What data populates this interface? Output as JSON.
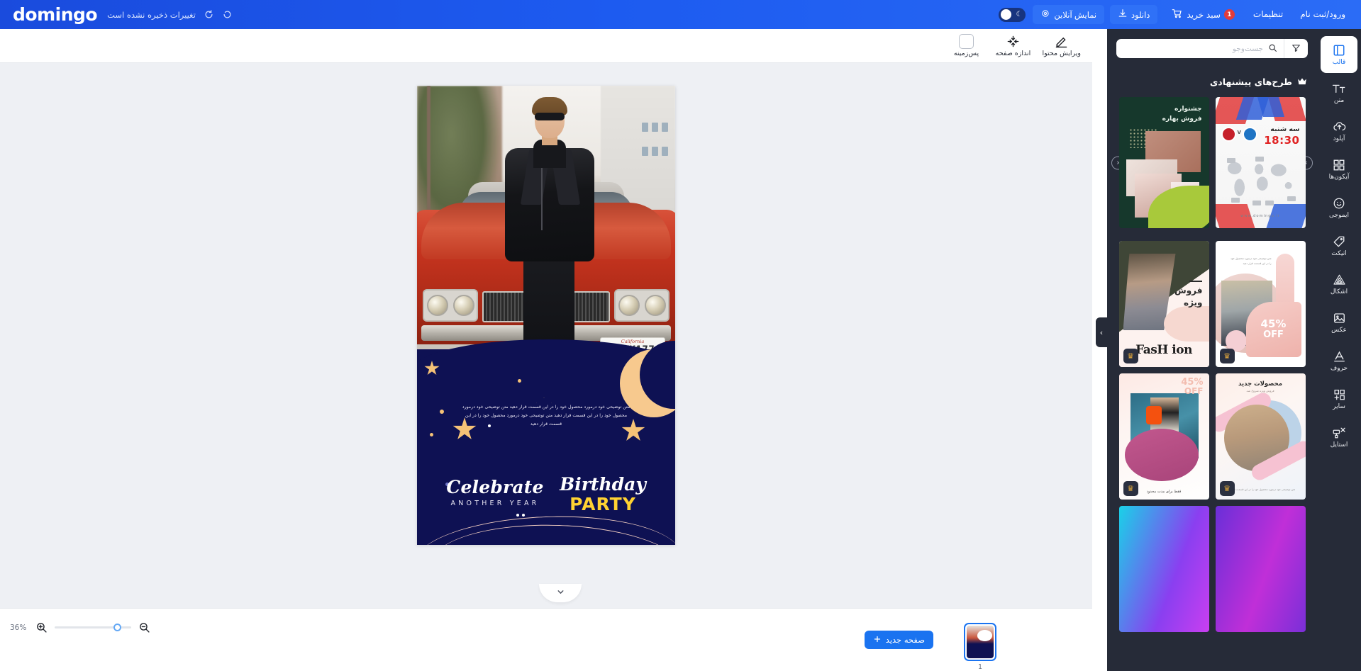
{
  "header": {
    "logo": "domingo",
    "save_status": "تغییرات ذخیره نشده است",
    "undo_icon": "undo-icon",
    "redo_icon": "redo-icon",
    "links": [
      {
        "label": "ورود/ثبت نام",
        "name": "login-register"
      },
      {
        "label": "تنظیمات",
        "name": "settings"
      }
    ],
    "cart": {
      "label": "سبد خرید",
      "badge": "1",
      "icon": "cart-icon"
    },
    "download": {
      "label": "دانلود",
      "icon": "download-icon"
    },
    "preview": {
      "label": "نمایش آنلاین",
      "icon": "eye-icon"
    },
    "theme_toggle": {
      "name": "dark-mode-toggle",
      "icon": "moon-icon",
      "state": "off"
    }
  },
  "toolbar": {
    "items": [
      {
        "label": "ویرایش محتوا",
        "icon": "pencil-icon",
        "name": "edit-content"
      },
      {
        "label": "اندازه صفحه",
        "icon": "resize-icon",
        "name": "page-size"
      },
      {
        "label": "پس‌زمینه",
        "icon": "background-swatch-icon",
        "name": "background"
      }
    ]
  },
  "canvas": {
    "design": {
      "plate_region": "California",
      "plate_number": "7ZWK177",
      "description": "متن توضیحی خود درمورد محصول خود را در این قسمت قرار دهید متن توضیحی خود درمورد محصول خود را در این قسمت قرار دهید متن توضیحی خود درمورد محصول خود را در این قسمت قرار دهید",
      "celebrate": "Celebrate",
      "another_year": "ANOTHER YEAR",
      "birthday": "Birthday",
      "party": "PARTY"
    },
    "scroll_down_icon": "chevron-down-icon"
  },
  "bottombar": {
    "zoom_percent": "36%",
    "zoom_in_icon": "zoom-in-icon",
    "zoom_out_icon": "zoom-out-icon",
    "new_page_label": "صفحه جدید",
    "new_page_icon": "plus-icon",
    "page_number": "1"
  },
  "panel": {
    "search_placeholder": "جست‌وجو",
    "search_value": "",
    "search_icon": "search-icon",
    "filter_icon": "filter-icon",
    "section_title": "طرح‌های پیشنهادی",
    "section_icon": "crown-icon",
    "carousel": {
      "prev_icon": "chevron-left-icon",
      "next_icon": "chevron-right-icon",
      "items": [
        {
          "name": "template-match-schedule",
          "day": "سه شنبه",
          "time": "18:30",
          "versus": "V",
          "url": "www.domingo.ir"
        },
        {
          "name": "template-spring-sale",
          "title_line1": "جشنواره",
          "title_line2": "فروش بهاره"
        }
      ]
    },
    "grid_items": [
      {
        "name": "template-45-off",
        "discount": "45%",
        "discount_label": "OFF",
        "body_text": "متن توضیحی خود درمورد محصول خود را در این قسمت قرار دهید",
        "premium": true,
        "badge_icon": "crown-icon"
      },
      {
        "name": "template-fashion-special-sale",
        "title_line1": "فروش",
        "title_line2": "ویژه",
        "wordmark": "FasH ion",
        "premium": true,
        "badge_icon": "crown-icon"
      },
      {
        "name": "template-new-products",
        "title": "محصولات جدید",
        "subtitle": "فروش ویژه شروع شد",
        "footer_text": "متن توضیحی خود درمورد محصول خود را در این قسمت قرار دهید",
        "premium": true,
        "badge_icon": "crown-icon"
      },
      {
        "name": "template-limited-time",
        "discount": "45%",
        "discount_label": "OFF",
        "caption": "فقط برای مدت محدود",
        "premium": true,
        "badge_icon": "crown-icon"
      },
      {
        "name": "template-purple-gradient",
        "premium": false
      },
      {
        "name": "template-cyan-gradient",
        "premium": false
      }
    ],
    "collapse_icon": "chevron-right-icon"
  },
  "rail": {
    "items": [
      {
        "label": "قالب",
        "icon": "layout-icon",
        "name": "rail-templates",
        "active": true
      },
      {
        "label": "متن",
        "icon": "text-icon",
        "name": "rail-text",
        "active": false
      },
      {
        "label": "آپلود",
        "icon": "upload-icon",
        "name": "rail-upload",
        "active": false
      },
      {
        "label": "آیکون‌ها",
        "icon": "grid-icon",
        "name": "rail-icons",
        "active": false
      },
      {
        "label": "ایموجی",
        "icon": "emoji-icon",
        "name": "rail-emoji",
        "active": false
      },
      {
        "label": "اتیکت",
        "icon": "tag-icon",
        "name": "rail-label",
        "active": false
      },
      {
        "label": "اشکال",
        "icon": "shapes-icon",
        "name": "rail-shapes",
        "active": false
      },
      {
        "label": "عکس",
        "icon": "image-icon",
        "name": "rail-photos",
        "active": false
      },
      {
        "label": "حروف",
        "icon": "font-icon",
        "name": "rail-fonts",
        "active": false
      },
      {
        "label": "سایر",
        "icon": "more-icon",
        "name": "rail-other",
        "active": false
      },
      {
        "label": "استایل",
        "icon": "style-icon",
        "name": "rail-style",
        "active": false
      }
    ]
  },
  "colors": {
    "brand_blue": "#1d5bf0",
    "panel_dark": "#262b38",
    "canvas_bg": "#eef0f4",
    "accent_yellow": "#ffd232",
    "design_navy": "#0e1153",
    "danger_red": "#e23b3b"
  }
}
